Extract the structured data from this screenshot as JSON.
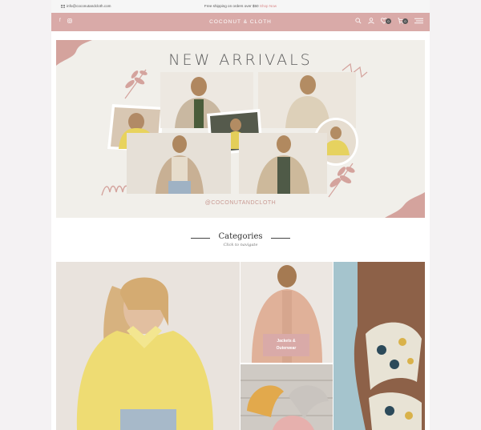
{
  "topbar": {
    "email": "info@coconutandcloth.com",
    "shipping": "Free shipping on orders over $50",
    "shop_now": "Shop Now"
  },
  "header": {
    "brand": "COCONUT & CLOTH",
    "wishlist_count": "0",
    "cart_count": "0"
  },
  "banner": {
    "title": "NEW ARRIVALS",
    "handle": "@COCONUTANDCLOTH"
  },
  "categories": {
    "title": "Categories",
    "subtitle": "Click to navigate",
    "items": [
      {
        "label": "Jackets &\nOuterwear"
      }
    ]
  },
  "colors": {
    "accent": "#d9aaa8",
    "link": "#d98a8a"
  }
}
